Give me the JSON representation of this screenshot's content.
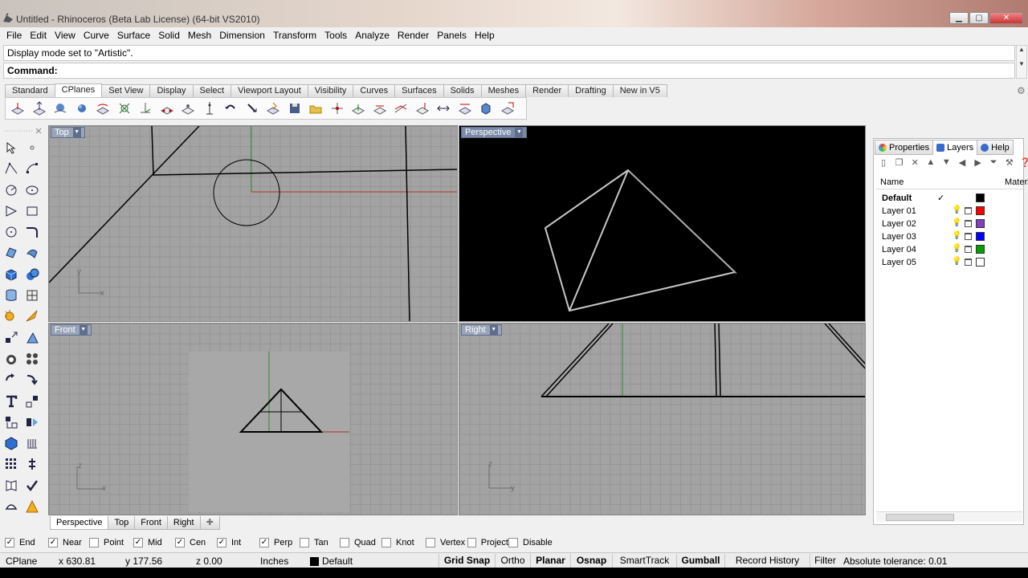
{
  "window": {
    "title": "Untitled - Rhinoceros (Beta Lab License) (64-bit VS2010)",
    "minimize": "▁",
    "maximize": "▢",
    "close": "✕"
  },
  "menu": [
    "File",
    "Edit",
    "View",
    "Curve",
    "Surface",
    "Solid",
    "Mesh",
    "Dimension",
    "Transform",
    "Tools",
    "Analyze",
    "Render",
    "Panels",
    "Help"
  ],
  "command": {
    "history": "Display mode set to \"Artistic\".",
    "prompt": "Command:",
    "value": ""
  },
  "toolbar_tabs": {
    "items": [
      "Standard",
      "CPlanes",
      "Set View",
      "Display",
      "Select",
      "Viewport Layout",
      "Visibility",
      "Curves",
      "Surfaces",
      "Solids",
      "Meshes",
      "Render",
      "Drafting",
      "New in V5"
    ],
    "active": "CPlanes"
  },
  "viewports": {
    "top": {
      "label": "Top",
      "axis_x": "x",
      "axis_y": "y"
    },
    "perspective": {
      "label": "Perspective"
    },
    "front": {
      "label": "Front",
      "axis_x": "x",
      "axis_y": "z"
    },
    "right": {
      "label": "Right",
      "axis_x": "y",
      "axis_y": "z"
    }
  },
  "viewport_tabs": {
    "items": [
      "Perspective",
      "Top",
      "Front",
      "Right"
    ],
    "add": "✚",
    "active": "Perspective"
  },
  "osnaps": [
    {
      "label": "End",
      "checked": true
    },
    {
      "label": "Near",
      "checked": true
    },
    {
      "label": "Point",
      "checked": false
    },
    {
      "label": "Mid",
      "checked": true
    },
    {
      "label": "Cen",
      "checked": true
    },
    {
      "label": "Int",
      "checked": true
    },
    {
      "label": "Perp",
      "checked": true
    },
    {
      "label": "Tan",
      "checked": false
    },
    {
      "label": "Quad",
      "checked": false
    },
    {
      "label": "Knot",
      "checked": false
    },
    {
      "label": "Vertex",
      "checked": false
    },
    {
      "label": "Project",
      "checked": false
    },
    {
      "label": "Disable",
      "checked": false
    }
  ],
  "status": {
    "cplane": "CPlane",
    "x": "x 630.81",
    "y": "y 177.56",
    "z": "z 0.00",
    "units": "Inches",
    "layer": "Default",
    "grid_snap": "Grid Snap",
    "ortho": "Ortho",
    "planar": "Planar",
    "osnap": "Osnap",
    "smarttrack": "SmartTrack",
    "gumball": "Gumball",
    "record_history": "Record History",
    "filter": "Filter",
    "tolerance": "Absolute tolerance: 0.01"
  },
  "panel": {
    "tabs": [
      "Properties",
      "Layers",
      "Help"
    ],
    "active": "Layers",
    "col_name": "Name",
    "col_material": "Material",
    "current_mark": "✓",
    "layers": [
      {
        "name": "Default",
        "color": "#000000",
        "current": true
      },
      {
        "name": "Layer 01",
        "color": "#ff0000",
        "current": false
      },
      {
        "name": "Layer 02",
        "color": "#8040c0",
        "current": false
      },
      {
        "name": "Layer 03",
        "color": "#0000ff",
        "current": false
      },
      {
        "name": "Layer 04",
        "color": "#00a000",
        "current": false
      },
      {
        "name": "Layer 05",
        "color": "#ffffff",
        "current": false
      }
    ]
  }
}
